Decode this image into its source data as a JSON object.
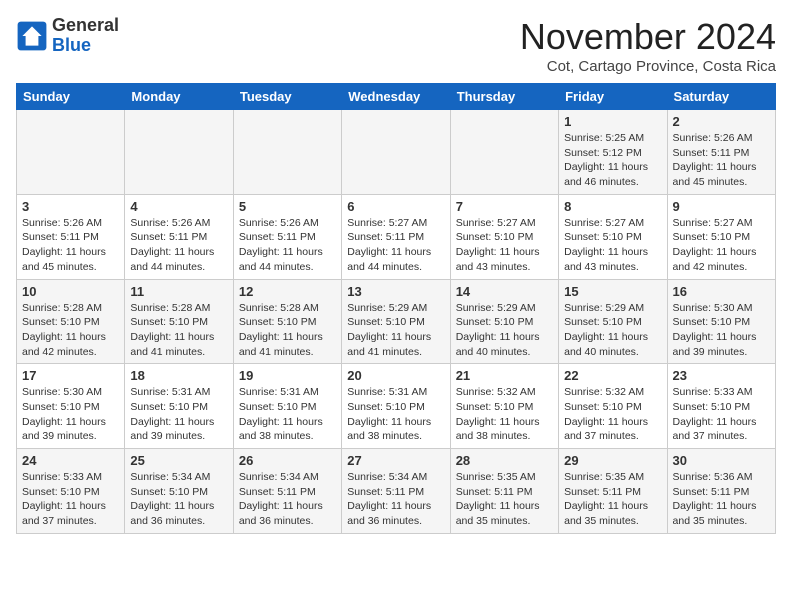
{
  "logo": {
    "line1": "General",
    "line2": "Blue"
  },
  "header": {
    "month": "November 2024",
    "location": "Cot, Cartago Province, Costa Rica"
  },
  "weekdays": [
    "Sunday",
    "Monday",
    "Tuesday",
    "Wednesday",
    "Thursday",
    "Friday",
    "Saturday"
  ],
  "weeks": [
    [
      {
        "day": "",
        "info": ""
      },
      {
        "day": "",
        "info": ""
      },
      {
        "day": "",
        "info": ""
      },
      {
        "day": "",
        "info": ""
      },
      {
        "day": "",
        "info": ""
      },
      {
        "day": "1",
        "info": "Sunrise: 5:25 AM\nSunset: 5:12 PM\nDaylight: 11 hours and 46 minutes."
      },
      {
        "day": "2",
        "info": "Sunrise: 5:26 AM\nSunset: 5:11 PM\nDaylight: 11 hours and 45 minutes."
      }
    ],
    [
      {
        "day": "3",
        "info": "Sunrise: 5:26 AM\nSunset: 5:11 PM\nDaylight: 11 hours and 45 minutes."
      },
      {
        "day": "4",
        "info": "Sunrise: 5:26 AM\nSunset: 5:11 PM\nDaylight: 11 hours and 44 minutes."
      },
      {
        "day": "5",
        "info": "Sunrise: 5:26 AM\nSunset: 5:11 PM\nDaylight: 11 hours and 44 minutes."
      },
      {
        "day": "6",
        "info": "Sunrise: 5:27 AM\nSunset: 5:11 PM\nDaylight: 11 hours and 44 minutes."
      },
      {
        "day": "7",
        "info": "Sunrise: 5:27 AM\nSunset: 5:10 PM\nDaylight: 11 hours and 43 minutes."
      },
      {
        "day": "8",
        "info": "Sunrise: 5:27 AM\nSunset: 5:10 PM\nDaylight: 11 hours and 43 minutes."
      },
      {
        "day": "9",
        "info": "Sunrise: 5:27 AM\nSunset: 5:10 PM\nDaylight: 11 hours and 42 minutes."
      }
    ],
    [
      {
        "day": "10",
        "info": "Sunrise: 5:28 AM\nSunset: 5:10 PM\nDaylight: 11 hours and 42 minutes."
      },
      {
        "day": "11",
        "info": "Sunrise: 5:28 AM\nSunset: 5:10 PM\nDaylight: 11 hours and 41 minutes."
      },
      {
        "day": "12",
        "info": "Sunrise: 5:28 AM\nSunset: 5:10 PM\nDaylight: 11 hours and 41 minutes."
      },
      {
        "day": "13",
        "info": "Sunrise: 5:29 AM\nSunset: 5:10 PM\nDaylight: 11 hours and 41 minutes."
      },
      {
        "day": "14",
        "info": "Sunrise: 5:29 AM\nSunset: 5:10 PM\nDaylight: 11 hours and 40 minutes."
      },
      {
        "day": "15",
        "info": "Sunrise: 5:29 AM\nSunset: 5:10 PM\nDaylight: 11 hours and 40 minutes."
      },
      {
        "day": "16",
        "info": "Sunrise: 5:30 AM\nSunset: 5:10 PM\nDaylight: 11 hours and 39 minutes."
      }
    ],
    [
      {
        "day": "17",
        "info": "Sunrise: 5:30 AM\nSunset: 5:10 PM\nDaylight: 11 hours and 39 minutes."
      },
      {
        "day": "18",
        "info": "Sunrise: 5:31 AM\nSunset: 5:10 PM\nDaylight: 11 hours and 39 minutes."
      },
      {
        "day": "19",
        "info": "Sunrise: 5:31 AM\nSunset: 5:10 PM\nDaylight: 11 hours and 38 minutes."
      },
      {
        "day": "20",
        "info": "Sunrise: 5:31 AM\nSunset: 5:10 PM\nDaylight: 11 hours and 38 minutes."
      },
      {
        "day": "21",
        "info": "Sunrise: 5:32 AM\nSunset: 5:10 PM\nDaylight: 11 hours and 38 minutes."
      },
      {
        "day": "22",
        "info": "Sunrise: 5:32 AM\nSunset: 5:10 PM\nDaylight: 11 hours and 37 minutes."
      },
      {
        "day": "23",
        "info": "Sunrise: 5:33 AM\nSunset: 5:10 PM\nDaylight: 11 hours and 37 minutes."
      }
    ],
    [
      {
        "day": "24",
        "info": "Sunrise: 5:33 AM\nSunset: 5:10 PM\nDaylight: 11 hours and 37 minutes."
      },
      {
        "day": "25",
        "info": "Sunrise: 5:34 AM\nSunset: 5:10 PM\nDaylight: 11 hours and 36 minutes."
      },
      {
        "day": "26",
        "info": "Sunrise: 5:34 AM\nSunset: 5:11 PM\nDaylight: 11 hours and 36 minutes."
      },
      {
        "day": "27",
        "info": "Sunrise: 5:34 AM\nSunset: 5:11 PM\nDaylight: 11 hours and 36 minutes."
      },
      {
        "day": "28",
        "info": "Sunrise: 5:35 AM\nSunset: 5:11 PM\nDaylight: 11 hours and 35 minutes."
      },
      {
        "day": "29",
        "info": "Sunrise: 5:35 AM\nSunset: 5:11 PM\nDaylight: 11 hours and 35 minutes."
      },
      {
        "day": "30",
        "info": "Sunrise: 5:36 AM\nSunset: 5:11 PM\nDaylight: 11 hours and 35 minutes."
      }
    ]
  ]
}
